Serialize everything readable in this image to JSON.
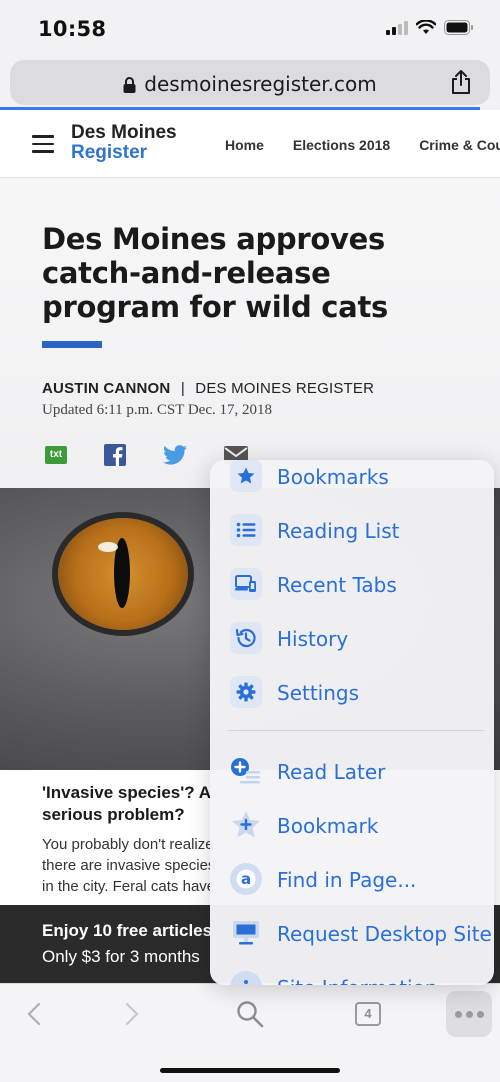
{
  "status": {
    "time": "10:58"
  },
  "browser": {
    "url": "desmoinesregister.com"
  },
  "site": {
    "logo_line1": "Des Moines",
    "logo_line2": "Register",
    "nav": [
      "Home",
      "Elections 2018",
      "Crime & Courts"
    ]
  },
  "article": {
    "headline": "Des Moines approves catch-and-release program for wild cats",
    "author": "AUSTIN CANNON",
    "separator": "|",
    "outlet": "DES MOINES REGISTER",
    "updated": "Updated 6:11 p.m. CST Dec. 17, 2018",
    "share_txt_label": "txt"
  },
  "teaser": {
    "title": "'Invasive species'? A serious problem?",
    "text": "You probably don't realize there are invasive species in the city. Feral cats have now made t"
  },
  "promo": {
    "line1": "Enjoy 10 free articles",
    "line2": "Only $3 for 3 months"
  },
  "toolbar": {
    "tab_count": "4"
  },
  "menu": {
    "items": [
      {
        "label": "Bookmarks",
        "icon": "star-icon"
      },
      {
        "label": "Reading List",
        "icon": "list-icon"
      },
      {
        "label": "Recent Tabs",
        "icon": "devices-icon"
      },
      {
        "label": "History",
        "icon": "history-icon"
      },
      {
        "label": "Settings",
        "icon": "gear-icon"
      },
      {
        "label": "Read Later",
        "icon": "read-later-icon"
      },
      {
        "label": "Bookmark",
        "icon": "add-bookmark-icon"
      },
      {
        "label": "Find in Page...",
        "icon": "find-icon"
      },
      {
        "label": "Request Desktop Site",
        "icon": "desktop-icon"
      },
      {
        "label": "Site Information",
        "icon": "info-icon"
      }
    ]
  },
  "colors": {
    "accent": "#2a6fd8",
    "brand_blue": "#2f74d0",
    "rule_blue": "#2b63c6"
  }
}
